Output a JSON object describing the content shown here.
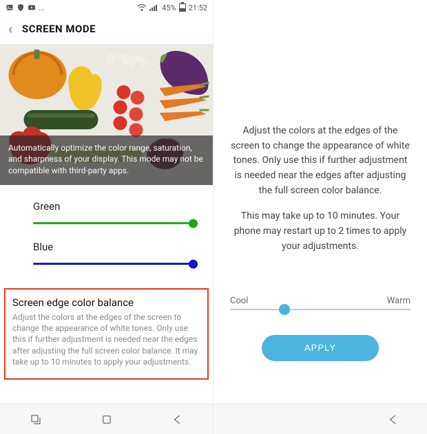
{
  "status": {
    "battery": "45%",
    "time": "21:52",
    "ellipsis": "..."
  },
  "header": {
    "title": "SCREEN MODE"
  },
  "hero": {
    "caption": "Automatically optimize the color range, saturation, and sharpness of your display. This mode may not be compatible with third-party apps."
  },
  "sliders": {
    "green": {
      "label": "Green",
      "track_color": "#1db31d",
      "thumb_color": "#17a817",
      "value_pct": 100
    },
    "blue": {
      "label": "Blue",
      "track_color": "#1717d0",
      "thumb_color": "#1212c0",
      "value_pct": 100
    }
  },
  "highlight": {
    "title": "Screen edge color balance",
    "body": "Adjust the colors at the edges of the screen to change the appearance of white tones. Only use this if further adjustment is needed near the edges after adjusting the full screen color balance. It may take up to 10 minutes to apply your adjustments."
  },
  "right": {
    "desc1": "Adjust the colors at the edges of the screen to change the appearance of white tones. Only use this if further adjustment is needed near the edges after adjusting the full screen color balance.",
    "desc2": "This may take up to 10 minutes. Your phone may restart up to 2 times to apply your adjustments.",
    "temp_cool": "Cool",
    "temp_warm": "Warm",
    "temp_value_pct": 30,
    "apply_label": "APPLY"
  }
}
